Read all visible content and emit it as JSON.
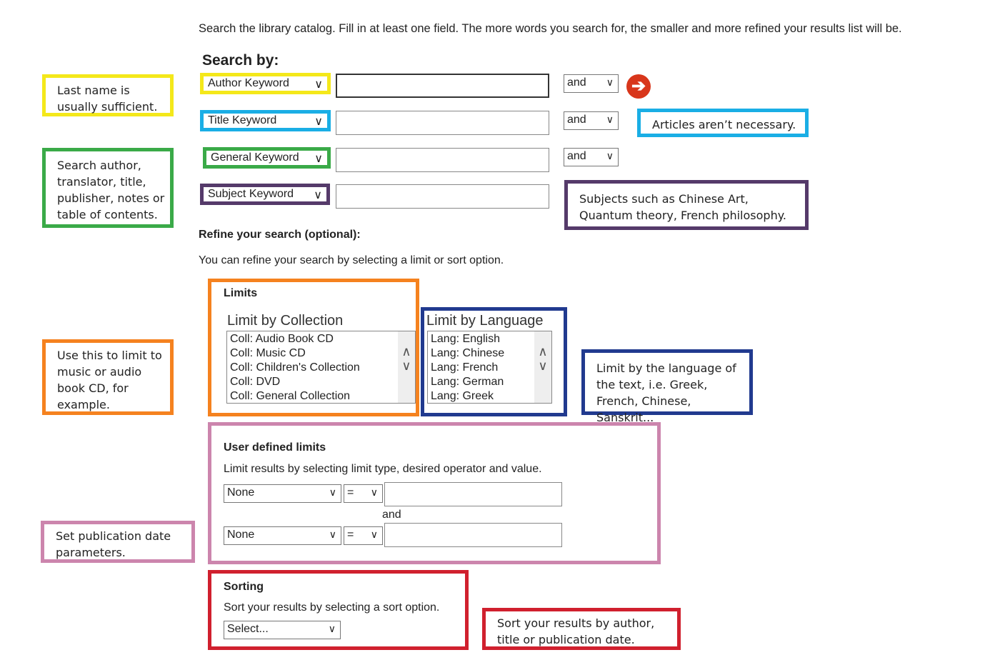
{
  "intro": "Search the library catalog. Fill in at least one field. The more words you search for, the smaller and more refined your results list will be.",
  "search": {
    "heading": "Search by:",
    "rows": [
      {
        "field": "Author Keyword",
        "op": "and"
      },
      {
        "field": "Title Keyword",
        "op": "and"
      },
      {
        "field": "General Keyword",
        "op": "and"
      },
      {
        "field": "Subject Keyword"
      }
    ],
    "submit_icon": "arrow-right-circle-icon"
  },
  "refine": {
    "heading": "Refine your search (optional):",
    "desc": "You can refine your search by selecting a limit or sort option."
  },
  "limits": {
    "heading": "Limits",
    "collection_label": "Limit by Collection",
    "collections": [
      "Coll: Audio Book CD",
      "Coll: Music CD",
      "Coll: Children's Collection",
      "Coll: DVD",
      "Coll: General Collection"
    ],
    "language_label": "Limit by Language",
    "languages": [
      "Lang: English",
      "Lang: Chinese",
      "Lang: French",
      "Lang: German",
      "Lang: Greek"
    ]
  },
  "user_limits": {
    "heading": "User defined limits",
    "desc": "Limit results by selecting limit type, desired operator and value.",
    "type1": "None",
    "op1": "=",
    "joiner": "and",
    "type2": "None",
    "op2": "="
  },
  "sorting": {
    "heading": "Sorting",
    "desc": "Sort your results by selecting a sort option.",
    "select": "Select..."
  },
  "callouts": {
    "author": "Last name is usually sufficient.",
    "title": "Articles aren’t necessary.",
    "general": "Search author, translator, title, publisher, notes or table of contents.",
    "subject": "Subjects such as Chinese Art, Quantum theory, French philosophy.",
    "collection": "Use this to limit to music or audio book CD, for example.",
    "language": "Limit by the language of the text, i.e. Greek, French, Chinese, Sanskrit...",
    "date": "Set publication date parameters.",
    "sort": "Sort your results by author, title or publication date."
  },
  "colors": {
    "yellow": "#f4e81a",
    "cyan": "#1aaee5",
    "green": "#3aaa48",
    "purple": "#553a6a",
    "orange": "#f5821f",
    "blue": "#213a8f",
    "pink": "#cc85ad",
    "red": "#d0202e",
    "submit": "#d8361b"
  }
}
